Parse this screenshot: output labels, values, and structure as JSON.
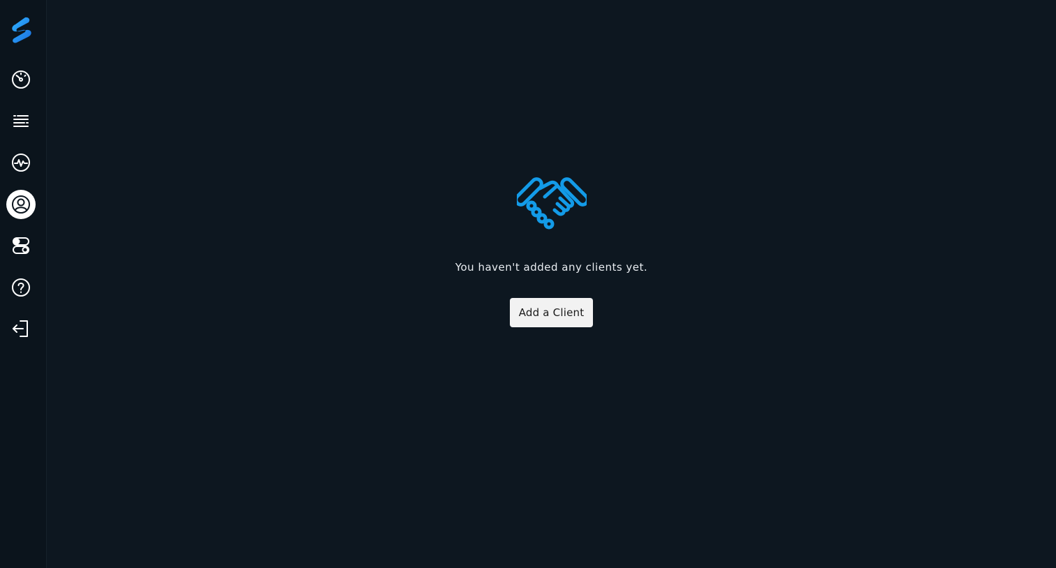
{
  "sidebar": {
    "logo": "app-logo",
    "items": [
      {
        "icon": "dashboard-gauge-icon",
        "active": false
      },
      {
        "icon": "list-icon",
        "active": false
      },
      {
        "icon": "activity-pulse-icon",
        "active": false
      },
      {
        "icon": "user-circle-icon",
        "active": true
      },
      {
        "icon": "toggles-icon",
        "active": false
      },
      {
        "icon": "help-question-icon",
        "active": false
      },
      {
        "icon": "logout-icon",
        "active": false
      }
    ]
  },
  "empty_state": {
    "icon": "handshake-icon",
    "message": "You haven't added any clients yet.",
    "button_label": "Add a Client"
  },
  "colors": {
    "background": "#0d1720",
    "sidebar": "#0b141c",
    "accent": "#139be8",
    "button_bg": "#f2f2f2"
  }
}
